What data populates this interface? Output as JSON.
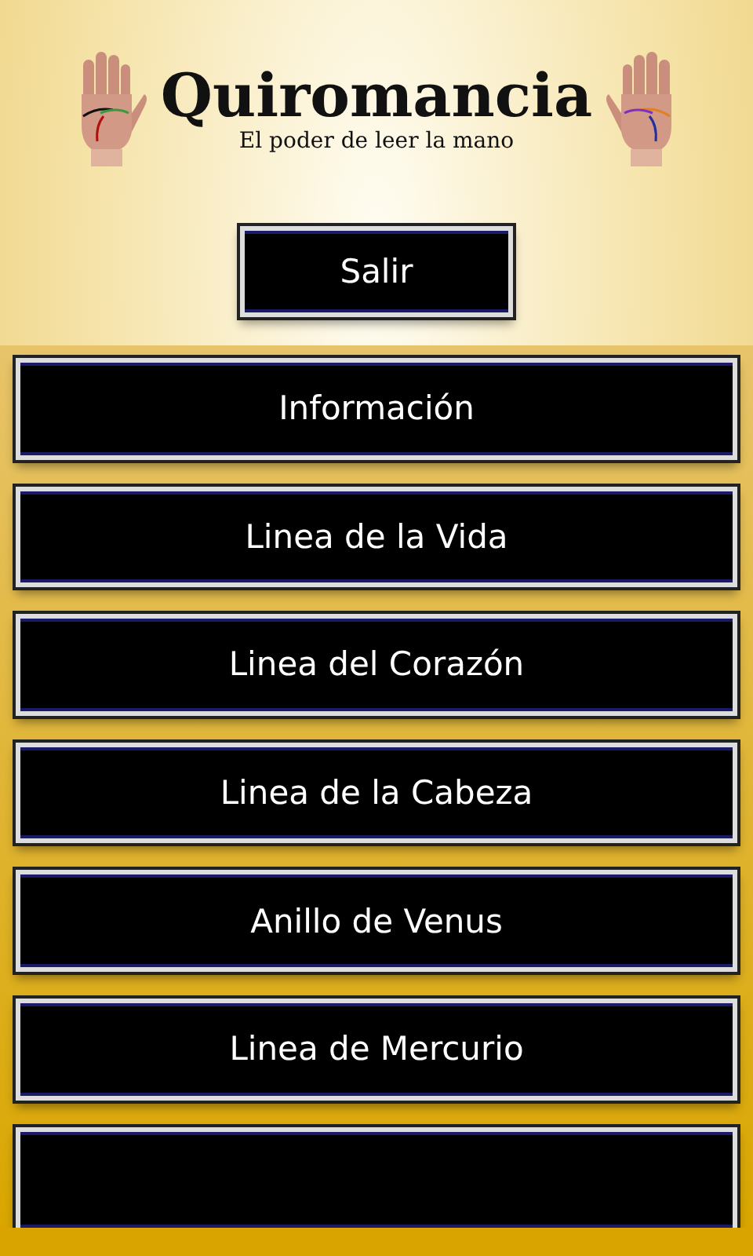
{
  "header": {
    "title": "Quiromancia",
    "subtitle": "El poder de leer la mano"
  },
  "exit_button": {
    "label": "Salir"
  },
  "menu": [
    {
      "label": "Información"
    },
    {
      "label": "Linea de la Vida"
    },
    {
      "label": "Linea del Corazón"
    },
    {
      "label": "Linea de la Cabeza"
    },
    {
      "label": "Anillo de Venus"
    },
    {
      "label": "Linea de Mercurio"
    }
  ]
}
